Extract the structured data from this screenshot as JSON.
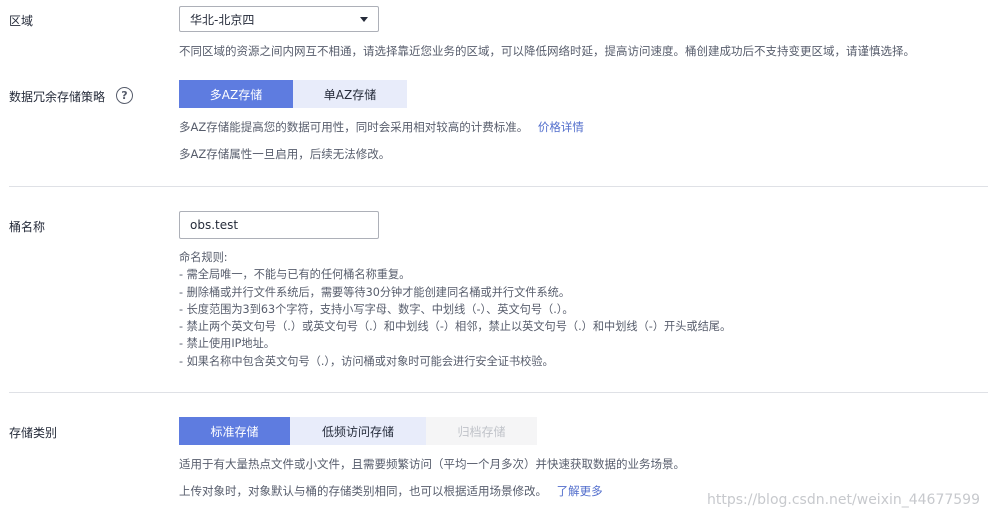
{
  "region": {
    "label": "区域",
    "selected": "华北-北京四",
    "help": "不同区域的资源之间内网互不相通，请选择靠近您业务的区域，可以降低网络时延，提高访问速度。桶创建成功后不支持变更区域，请谨慎选择。"
  },
  "redundancy": {
    "label": "数据冗余存储策略",
    "help_icon": "?",
    "options": [
      "多AZ存储",
      "单AZ存储"
    ],
    "selected_index": 0,
    "desc_text": "多AZ存储能提高您的数据可用性，同时会采用相对较高的计费标准。",
    "desc_link": "价格详情",
    "note": "多AZ存储属性一旦启用，后续无法修改。"
  },
  "bucket_name": {
    "label": "桶名称",
    "value": "obs.test",
    "rules": [
      "命名规则:",
      "- 需全局唯一，不能与已有的任何桶名称重复。",
      "- 删除桶或并行文件系统后，需要等待30分钟才能创建同名桶或并行文件系统。",
      "- 长度范围为3到63个字符，支持小写字母、数字、中划线（-）、英文句号（.）。",
      "- 禁止两个英文句号（.）或英文句号（.）和中划线（-）相邻，禁止以英文句号（.）和中划线（-）开头或结尾。",
      "- 禁止使用IP地址。",
      "- 如果名称中包含英文句号（.），访问桶或对象时可能会进行安全证书校验。"
    ]
  },
  "storage_class": {
    "label": "存储类别",
    "options": [
      "标准存储",
      "低频访问存储",
      "归档存储"
    ],
    "selected_index": 0,
    "disabled_index": 2,
    "desc": "适用于有大量热点文件或小文件，且需要频繁访问（平均一个月多次）并快速获取数据的业务场景。",
    "note_text": "上传对象时，对象默认与桶的存储类别相同，也可以根据适用场景修改。",
    "note_link": "了解更多"
  },
  "watermark": "https://blog.csdn.net/weixin_44677599"
}
